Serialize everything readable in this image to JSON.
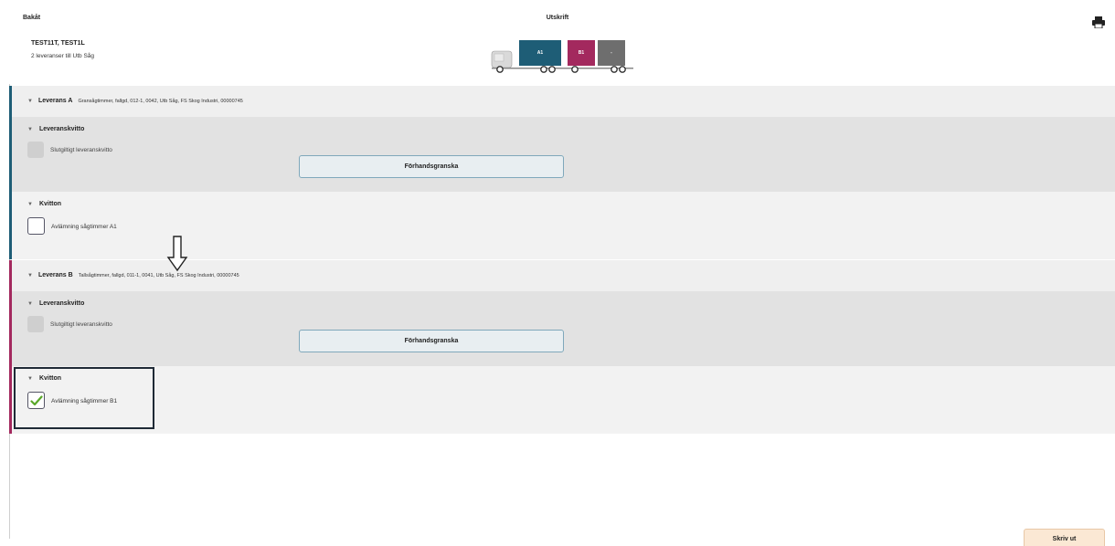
{
  "header": {
    "back_label": "Bakåt",
    "title": "Utskrift",
    "print_icon": "printer-icon"
  },
  "transport": {
    "title": "TEST11T, TEST1L",
    "subtitle": "2 leveranser till Utb Såg"
  },
  "truck": {
    "slots": [
      {
        "label": "A1",
        "color": "#1e5d76"
      },
      {
        "label": "B1",
        "color": "#a3295e"
      },
      {
        "label": "-",
        "color": "#6e6e6e"
      }
    ]
  },
  "deliveries": [
    {
      "name": "Leverans A",
      "description": "Gransågtimmer, fallgd, 012-1, 0042, Utb Såg, FS Skog Industri, 00000745",
      "accent": "#1e5d76",
      "receipt_section": {
        "title": "Leveranskvitto",
        "final_label": "Slutgiltigt leveranskvitto",
        "preview_label": "Förhandsgranska"
      },
      "kvitton": {
        "title": "Kvitton",
        "item_label": "Avlämning sågtimmer A1",
        "checked": false
      }
    },
    {
      "name": "Leverans B",
      "description": "Tallsågtimmer, fallgd, 011-1, 0041, Utb Såg, FS Skog Industri, 00000745",
      "accent": "#a3295e",
      "receipt_section": {
        "title": "Leveranskvitto",
        "final_label": "Slutgiltigt leveranskvitto",
        "preview_label": "Förhandsgranska"
      },
      "kvitton": {
        "title": "Kvitton",
        "item_label": "Avlämning sågtimmer B1",
        "checked": true
      }
    }
  ],
  "footer": {
    "print_label": "Skriv ut"
  }
}
